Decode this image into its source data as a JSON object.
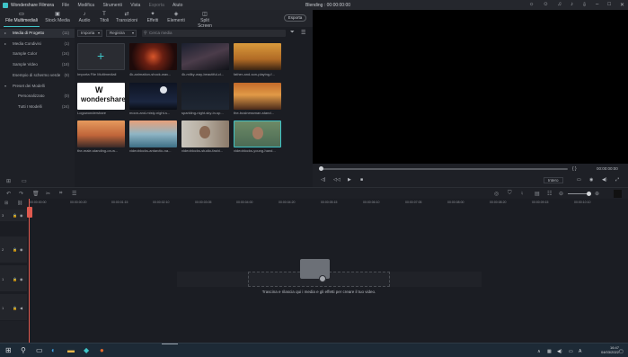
{
  "titlebar": {
    "app_name": "Wondershare Filmora",
    "menu": [
      "File",
      "Modifica",
      "Strumenti",
      "Vista",
      "Esporta",
      "Aiuto"
    ],
    "project_status": "Blending : 00:00:00:00"
  },
  "toolbar": {
    "tabs": [
      {
        "label": "File Multimediali",
        "icon": "folder-icon"
      },
      {
        "label": "Stock Media",
        "icon": "stock-icon"
      },
      {
        "label": "Audio",
        "icon": "music-icon"
      },
      {
        "label": "Titoli",
        "icon": "text-icon"
      },
      {
        "label": "Transizioni",
        "icon": "transition-icon"
      },
      {
        "label": "Effetti",
        "icon": "effects-icon"
      },
      {
        "label": "Elementi",
        "icon": "elements-icon"
      },
      {
        "label": "Split Screen",
        "icon": "split-screen-icon"
      }
    ],
    "export_label": "Esporta"
  },
  "sidebar": {
    "items": [
      {
        "label": "Media di Progetto",
        "count": "(11)"
      },
      {
        "label": "Media Condivisi",
        "count": "(1)"
      },
      {
        "label": "Sample Color",
        "count": "(24)"
      },
      {
        "label": "Sample Video",
        "count": "(18)"
      },
      {
        "label": "Esempio di schermo verde",
        "count": "(9)"
      },
      {
        "label": "Preset dei Modelli",
        "count": ""
      },
      {
        "label": "Personalizzato",
        "count": "(0)"
      },
      {
        "label": "Tutti I Modelli",
        "count": "(24)"
      }
    ]
  },
  "media": {
    "import_dropdown": "Importa",
    "record_dropdown": "Registra",
    "search_placeholder": "Cerca media",
    "items": [
      {
        "label": "Importa File Multimediali"
      },
      {
        "label": "4k-animation-shock-wav..."
      },
      {
        "label": "4k-milky-way-beautiful-cl..."
      },
      {
        "label": "father-and-son-playing-f..."
      },
      {
        "label": "Logowondershare"
      },
      {
        "label": "moon-and-misty-night-s..."
      },
      {
        "label": "sparkling-night-sky-in-sp..."
      },
      {
        "label": "the-businessman-stand..."
      },
      {
        "label": "the-male-standing-on-w..."
      },
      {
        "label": "videoblocks-antarctic-na..."
      },
      {
        "label": "videoblocks-studio-fashi..."
      },
      {
        "label": "videoblocks-young-hand..."
      }
    ],
    "logo_text": "wondershare"
  },
  "preview": {
    "timecode": "00:00:00:00",
    "quality": "Intero"
  },
  "timeline": {
    "ruler": [
      "00:00:00:00",
      "00:00:00:20",
      "00:00:01:15",
      "00:00:02:10",
      "00:00:03:05",
      "00:00:04:00",
      "00:00:04:20",
      "00:00:05:15",
      "00:00:06:10",
      "00:00:07:05",
      "00:00:08:00",
      "00:00:08:20",
      "00:00:09:15",
      "00:00:10:10"
    ],
    "track_labels": [
      "3",
      "2",
      "1",
      "1"
    ],
    "drop_text": "Trascina e rilascia qui i media e gli effetti per creare il tuo video."
  },
  "taskbar": {
    "time": "16:47",
    "date": "04/03/2022"
  },
  "colors": {
    "accent": "#3fc4c7",
    "playhead": "#e05a4f"
  }
}
